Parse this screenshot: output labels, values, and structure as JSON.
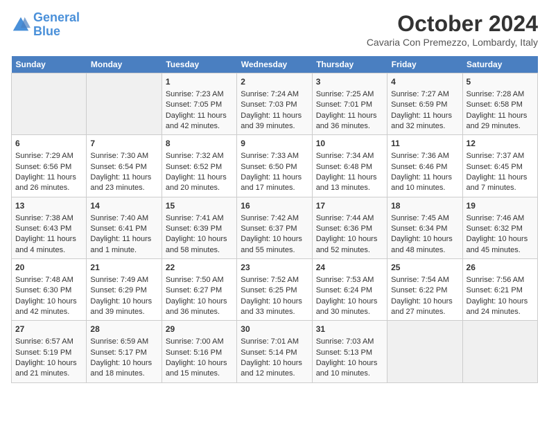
{
  "logo": {
    "line1": "General",
    "line2": "Blue"
  },
  "title": "October 2024",
  "subtitle": "Cavaria Con Premezzo, Lombardy, Italy",
  "days_of_week": [
    "Sunday",
    "Monday",
    "Tuesday",
    "Wednesday",
    "Thursday",
    "Friday",
    "Saturday"
  ],
  "weeks": [
    [
      {
        "day": "",
        "info": ""
      },
      {
        "day": "",
        "info": ""
      },
      {
        "day": "1",
        "info": "Sunrise: 7:23 AM\nSunset: 7:05 PM\nDaylight: 11 hours and 42 minutes."
      },
      {
        "day": "2",
        "info": "Sunrise: 7:24 AM\nSunset: 7:03 PM\nDaylight: 11 hours and 39 minutes."
      },
      {
        "day": "3",
        "info": "Sunrise: 7:25 AM\nSunset: 7:01 PM\nDaylight: 11 hours and 36 minutes."
      },
      {
        "day": "4",
        "info": "Sunrise: 7:27 AM\nSunset: 6:59 PM\nDaylight: 11 hours and 32 minutes."
      },
      {
        "day": "5",
        "info": "Sunrise: 7:28 AM\nSunset: 6:58 PM\nDaylight: 11 hours and 29 minutes."
      }
    ],
    [
      {
        "day": "6",
        "info": "Sunrise: 7:29 AM\nSunset: 6:56 PM\nDaylight: 11 hours and 26 minutes."
      },
      {
        "day": "7",
        "info": "Sunrise: 7:30 AM\nSunset: 6:54 PM\nDaylight: 11 hours and 23 minutes."
      },
      {
        "day": "8",
        "info": "Sunrise: 7:32 AM\nSunset: 6:52 PM\nDaylight: 11 hours and 20 minutes."
      },
      {
        "day": "9",
        "info": "Sunrise: 7:33 AM\nSunset: 6:50 PM\nDaylight: 11 hours and 17 minutes."
      },
      {
        "day": "10",
        "info": "Sunrise: 7:34 AM\nSunset: 6:48 PM\nDaylight: 11 hours and 13 minutes."
      },
      {
        "day": "11",
        "info": "Sunrise: 7:36 AM\nSunset: 6:46 PM\nDaylight: 11 hours and 10 minutes."
      },
      {
        "day": "12",
        "info": "Sunrise: 7:37 AM\nSunset: 6:45 PM\nDaylight: 11 hours and 7 minutes."
      }
    ],
    [
      {
        "day": "13",
        "info": "Sunrise: 7:38 AM\nSunset: 6:43 PM\nDaylight: 11 hours and 4 minutes."
      },
      {
        "day": "14",
        "info": "Sunrise: 7:40 AM\nSunset: 6:41 PM\nDaylight: 11 hours and 1 minute."
      },
      {
        "day": "15",
        "info": "Sunrise: 7:41 AM\nSunset: 6:39 PM\nDaylight: 10 hours and 58 minutes."
      },
      {
        "day": "16",
        "info": "Sunrise: 7:42 AM\nSunset: 6:37 PM\nDaylight: 10 hours and 55 minutes."
      },
      {
        "day": "17",
        "info": "Sunrise: 7:44 AM\nSunset: 6:36 PM\nDaylight: 10 hours and 52 minutes."
      },
      {
        "day": "18",
        "info": "Sunrise: 7:45 AM\nSunset: 6:34 PM\nDaylight: 10 hours and 48 minutes."
      },
      {
        "day": "19",
        "info": "Sunrise: 7:46 AM\nSunset: 6:32 PM\nDaylight: 10 hours and 45 minutes."
      }
    ],
    [
      {
        "day": "20",
        "info": "Sunrise: 7:48 AM\nSunset: 6:30 PM\nDaylight: 10 hours and 42 minutes."
      },
      {
        "day": "21",
        "info": "Sunrise: 7:49 AM\nSunset: 6:29 PM\nDaylight: 10 hours and 39 minutes."
      },
      {
        "day": "22",
        "info": "Sunrise: 7:50 AM\nSunset: 6:27 PM\nDaylight: 10 hours and 36 minutes."
      },
      {
        "day": "23",
        "info": "Sunrise: 7:52 AM\nSunset: 6:25 PM\nDaylight: 10 hours and 33 minutes."
      },
      {
        "day": "24",
        "info": "Sunrise: 7:53 AM\nSunset: 6:24 PM\nDaylight: 10 hours and 30 minutes."
      },
      {
        "day": "25",
        "info": "Sunrise: 7:54 AM\nSunset: 6:22 PM\nDaylight: 10 hours and 27 minutes."
      },
      {
        "day": "26",
        "info": "Sunrise: 7:56 AM\nSunset: 6:21 PM\nDaylight: 10 hours and 24 minutes."
      }
    ],
    [
      {
        "day": "27",
        "info": "Sunrise: 6:57 AM\nSunset: 5:19 PM\nDaylight: 10 hours and 21 minutes."
      },
      {
        "day": "28",
        "info": "Sunrise: 6:59 AM\nSunset: 5:17 PM\nDaylight: 10 hours and 18 minutes."
      },
      {
        "day": "29",
        "info": "Sunrise: 7:00 AM\nSunset: 5:16 PM\nDaylight: 10 hours and 15 minutes."
      },
      {
        "day": "30",
        "info": "Sunrise: 7:01 AM\nSunset: 5:14 PM\nDaylight: 10 hours and 12 minutes."
      },
      {
        "day": "31",
        "info": "Sunrise: 7:03 AM\nSunset: 5:13 PM\nDaylight: 10 hours and 10 minutes."
      },
      {
        "day": "",
        "info": ""
      },
      {
        "day": "",
        "info": ""
      }
    ]
  ]
}
